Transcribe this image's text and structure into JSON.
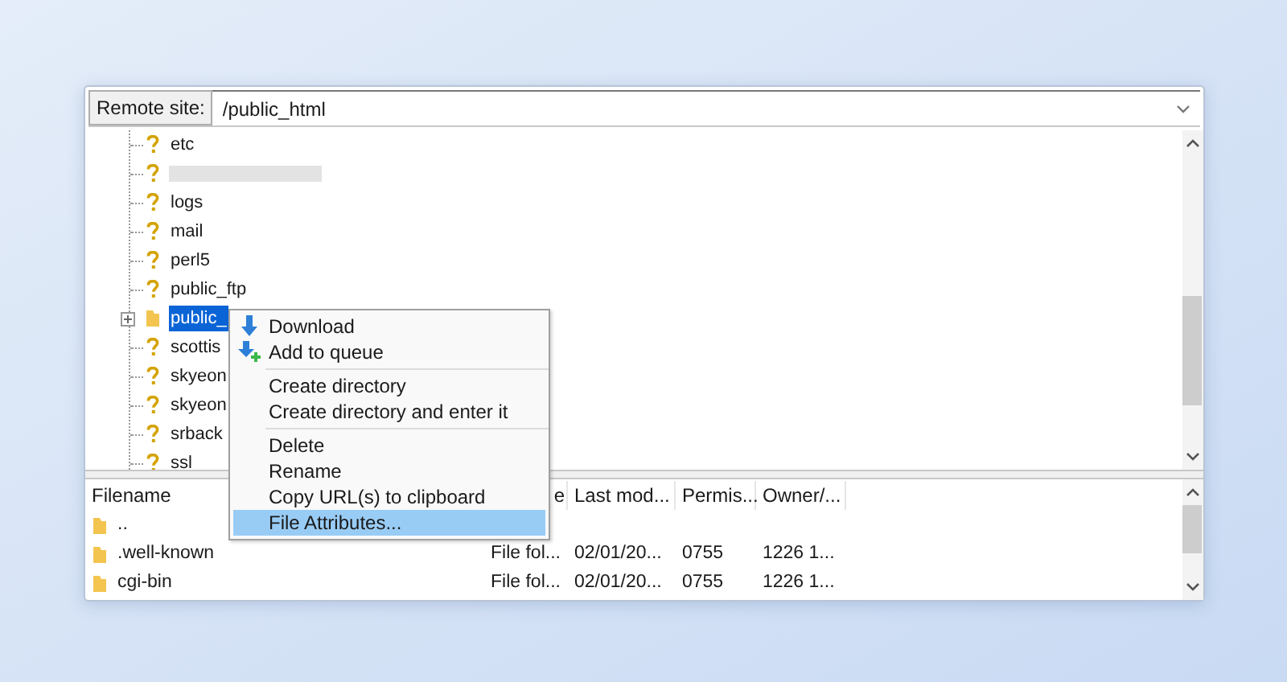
{
  "remote_site": {
    "label": "Remote site:",
    "value": "/public_html"
  },
  "tree": {
    "items": [
      {
        "kind": "unknown",
        "label": "etc",
        "selected": false
      },
      {
        "kind": "redacted",
        "selected": false
      },
      {
        "kind": "unknown",
        "label": "logs",
        "selected": false
      },
      {
        "kind": "unknown",
        "label": "mail",
        "selected": false
      },
      {
        "kind": "unknown",
        "label": "perl5",
        "selected": false
      },
      {
        "kind": "unknown",
        "label": "public_ftp",
        "selected": false
      },
      {
        "kind": "folder",
        "label": "public_",
        "selected": true,
        "expandable": true
      },
      {
        "kind": "unknown",
        "label": "scottis",
        "selected": false
      },
      {
        "kind": "unknown",
        "label": "skyeon",
        "selected": false
      },
      {
        "kind": "unknown",
        "label": "skyeon",
        "selected": false
      },
      {
        "kind": "unknown",
        "label": "srback",
        "selected": false
      },
      {
        "kind": "unknown",
        "label": "ssl",
        "selected": false
      }
    ]
  },
  "context_menu": {
    "items": [
      {
        "kind": "download",
        "label": "Download",
        "selected": false
      },
      {
        "kind": "queue",
        "label": "Add to queue",
        "selected": false
      },
      {
        "kind": "separator"
      },
      {
        "kind": "plain",
        "label": "Create directory",
        "selected": false
      },
      {
        "kind": "plain",
        "label": "Create directory and enter it",
        "selected": false
      },
      {
        "kind": "separator"
      },
      {
        "kind": "plain",
        "label": "Delete",
        "selected": false
      },
      {
        "kind": "plain",
        "label": "Rename",
        "selected": false
      },
      {
        "kind": "plain",
        "label": "Copy URL(s) to clipboard",
        "selected": false
      },
      {
        "kind": "plain",
        "label": "File Attributes...",
        "selected": true
      }
    ]
  },
  "file_list": {
    "columns": [
      "Filename",
      "e",
      "Last mod...",
      "Permis...",
      "Owner/..."
    ],
    "rows": [
      {
        "cells": [
          ".."
        ]
      },
      {
        "cells": [
          ".well-known",
          "File fol...",
          "02/01/20...",
          "0755",
          "1226 1..."
        ]
      },
      {
        "cells": [
          "cgi-bin",
          "File fol...",
          "02/01/20...",
          "0755",
          "1226 1..."
        ]
      }
    ]
  }
}
